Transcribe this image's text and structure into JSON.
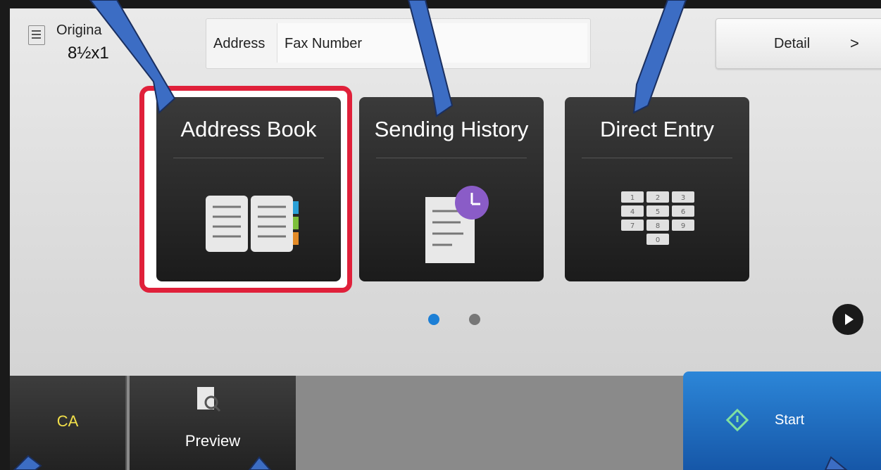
{
  "original": {
    "label": "Origina",
    "size": "8½x1"
  },
  "address": {
    "label": "Address",
    "value": "Fax Number"
  },
  "detail": {
    "label": "Detail",
    "arrow": ">"
  },
  "tiles": [
    {
      "title": "Address Book",
      "icon": "address-book-icon"
    },
    {
      "title": "Sending History",
      "icon": "history-icon"
    },
    {
      "title": "Direct Entry",
      "icon": "keypad-icon"
    }
  ],
  "keypad": [
    "1",
    "2",
    "3",
    "4",
    "5",
    "6",
    "7",
    "8",
    "9",
    "0"
  ],
  "pager": {
    "pages": 2,
    "current": 1
  },
  "bottom": {
    "ca": "CA",
    "preview": "Preview",
    "start": "Start"
  },
  "colors": {
    "highlight": "#e0203a",
    "start": "#1e6fc4",
    "callout": "#3c6dc4",
    "dot_active": "#1c7fd6",
    "ca_text": "#f2e04a"
  }
}
